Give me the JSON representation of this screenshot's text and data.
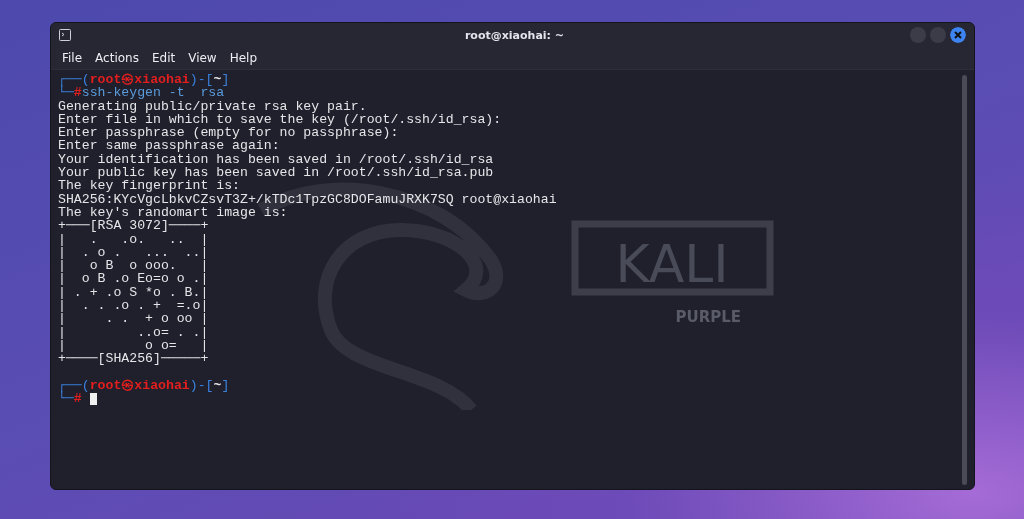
{
  "window": {
    "title": "root@xiaohai: ~"
  },
  "menu": [
    "File",
    "Actions",
    "Edit",
    "View",
    "Help"
  ],
  "watermark": {
    "name": "KALI",
    "sub": "PURPLE"
  },
  "terminal": {
    "lines": [
      {
        "kind": "prompt",
        "top_left": "┌──(",
        "user": "root㉿xiaohai",
        "sep": ")-[",
        "dir": "~",
        "top_right": "]",
        "bottom": "└─",
        "symbol": "#",
        "command": "ssh-keygen -t  rsa",
        "cursor": false
      },
      {
        "kind": "output",
        "text": "Generating public/private rsa key pair."
      },
      {
        "kind": "output",
        "text": "Enter file in which to save the key (/root/.ssh/id_rsa):"
      },
      {
        "kind": "output",
        "text": "Enter passphrase (empty for no passphrase):"
      },
      {
        "kind": "output",
        "text": "Enter same passphrase again:"
      },
      {
        "kind": "output",
        "text": "Your identification has been saved in /root/.ssh/id_rsa"
      },
      {
        "kind": "output",
        "text": "Your public key has been saved in /root/.ssh/id_rsa.pub"
      },
      {
        "kind": "output",
        "text": "The key fingerprint is:"
      },
      {
        "kind": "output",
        "text": "SHA256:KYcVgcLbkvCZsvT3Z+/kTDc1TpzGC8DOFamuJRXK7SQ root@xiaohai"
      },
      {
        "kind": "output",
        "text": "The key's randomart image is:"
      },
      {
        "kind": "art",
        "text": "+───[RSA 3072]────+"
      },
      {
        "kind": "art",
        "text": "|   .   .o.   ..  |"
      },
      {
        "kind": "art",
        "text": "|  . o .   ...  ..|"
      },
      {
        "kind": "art",
        "text": "|   o B  o ooo.   |"
      },
      {
        "kind": "art",
        "text": "|  o B .o Eo=o o .|"
      },
      {
        "kind": "art",
        "text": "| . + .o S *o . B.|"
      },
      {
        "kind": "art",
        "text": "|  . . .o . +  =.o|"
      },
      {
        "kind": "art",
        "text": "|     . .  + o oo |"
      },
      {
        "kind": "art",
        "text": "|         ..o= . .|"
      },
      {
        "kind": "art",
        "text": "|          o o=   |"
      },
      {
        "kind": "art",
        "text": "+────[SHA256]─────+"
      },
      {
        "kind": "blank"
      },
      {
        "kind": "prompt",
        "top_left": "┌──(",
        "user": "root㉿xiaohai",
        "sep": ")-[",
        "dir": "~",
        "top_right": "]",
        "bottom": "└─",
        "symbol": "#",
        "cursor": true
      }
    ]
  }
}
